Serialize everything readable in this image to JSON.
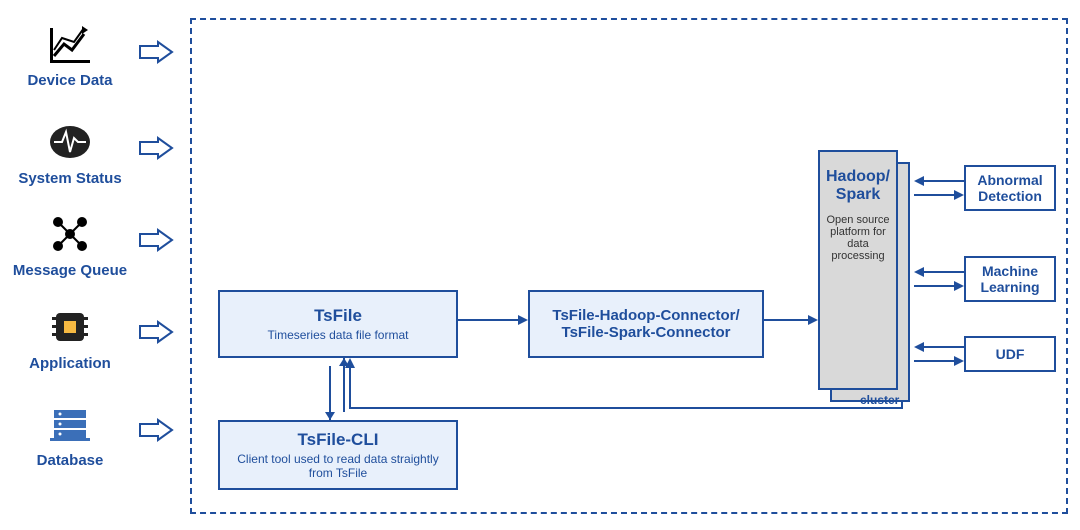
{
  "sources": [
    {
      "label": "Device Data",
      "icon": "chart-icon"
    },
    {
      "label": "System Status",
      "icon": "pulse-icon"
    },
    {
      "label": "Message Queue",
      "icon": "network-icon"
    },
    {
      "label": "Application",
      "icon": "chip-icon"
    },
    {
      "label": "Database",
      "icon": "server-icon"
    }
  ],
  "nodes": {
    "tsfile": {
      "title": "TsFile",
      "subtitle": "Timeseries data file format"
    },
    "connector": {
      "title_line1": "TsFile-Hadoop-Connector/",
      "title_line2": "TsFile-Spark-Connector"
    },
    "cli": {
      "title": "TsFile-CLI",
      "subtitle": "Client tool used to read data straightly from TsFile"
    },
    "hadoop": {
      "title_line1": "Hadoop/",
      "title_line2": "Spark",
      "subtitle": "Open source platform for data processing",
      "cluster_label": "cluster"
    }
  },
  "outputs": [
    {
      "label_line1": "Abnormal",
      "label_line2": "Detection"
    },
    {
      "label_line1": "Machine",
      "label_line2": "Learning"
    },
    {
      "label_line1": "UDF",
      "label_line2": ""
    }
  ]
}
